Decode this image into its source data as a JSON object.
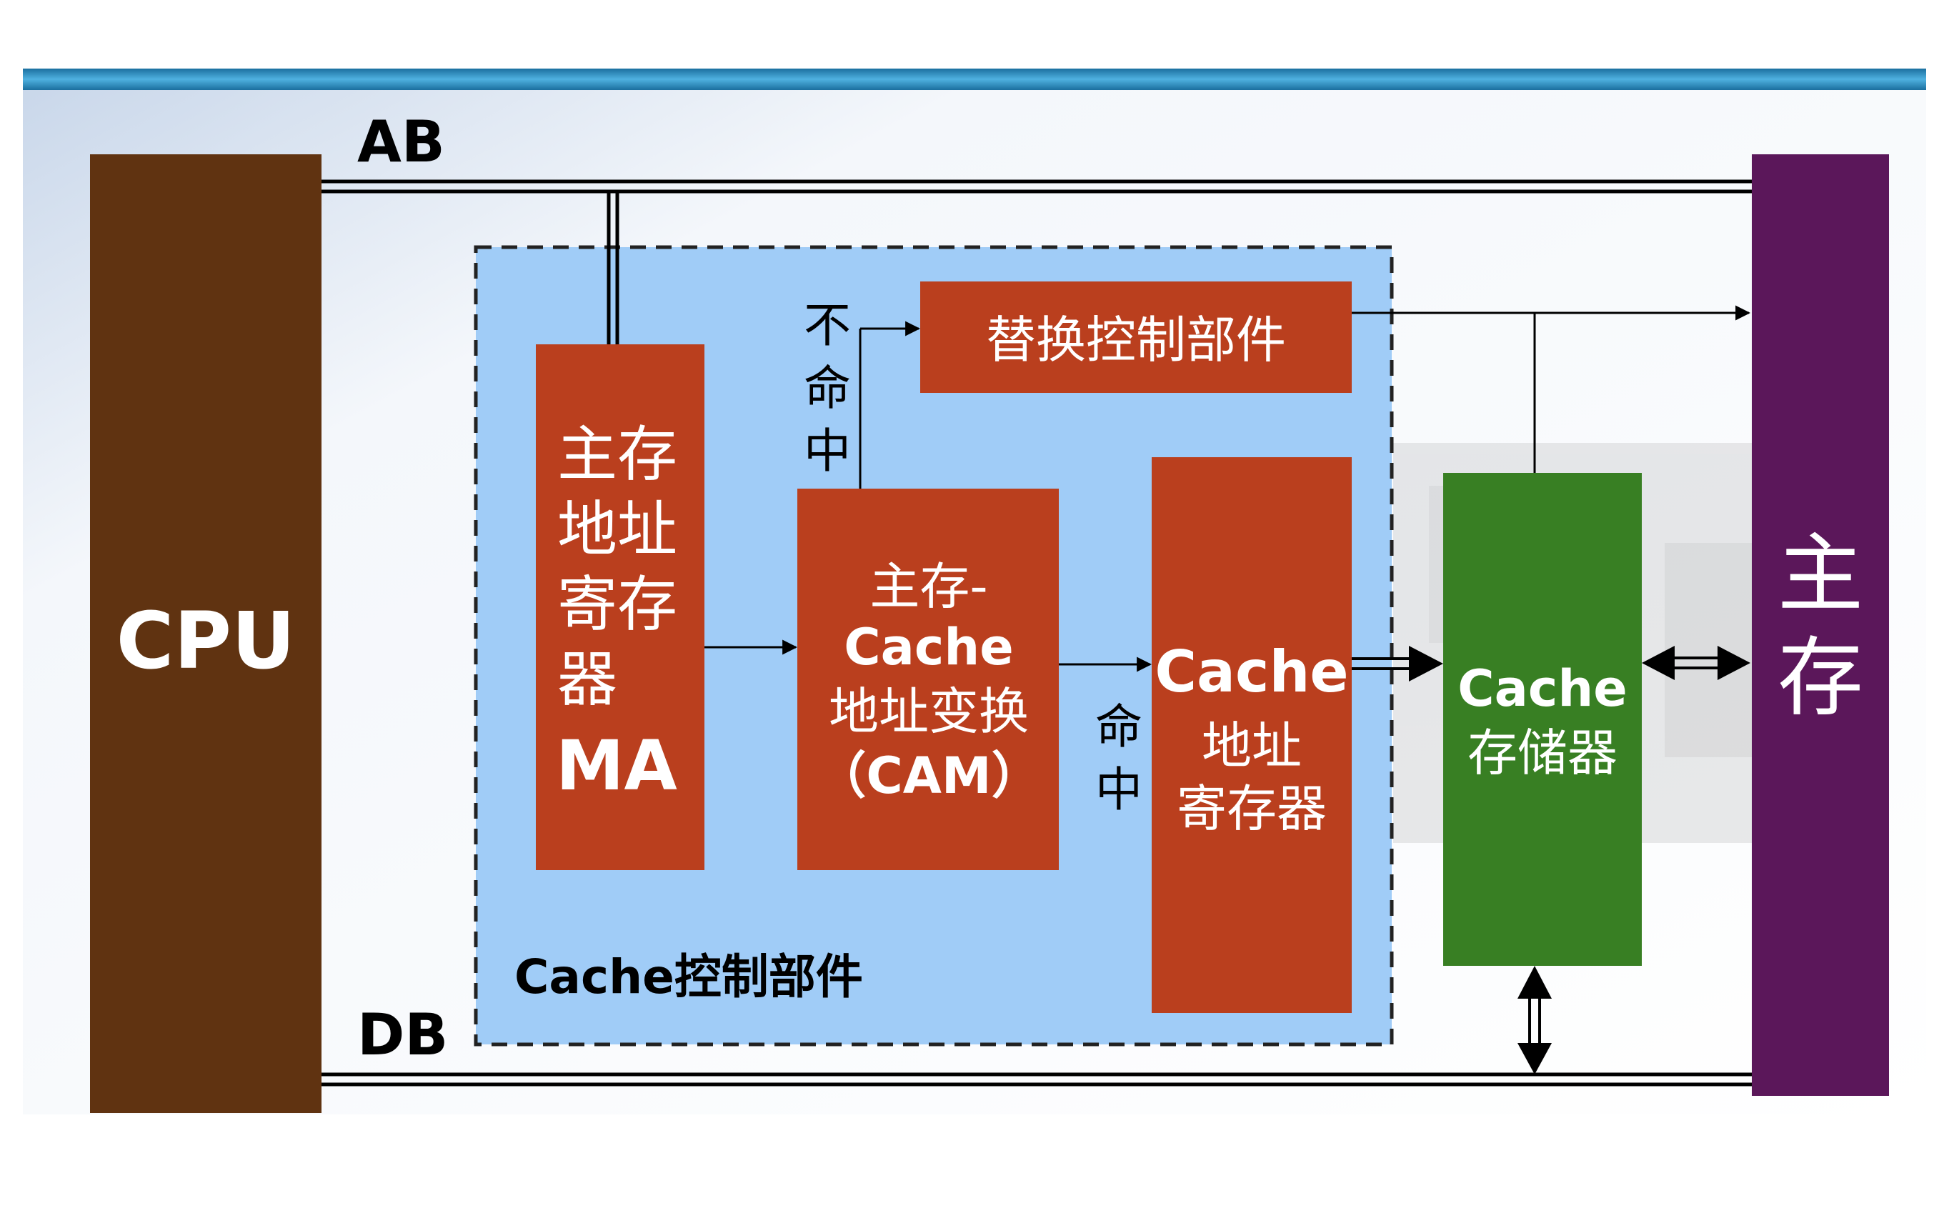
{
  "colors": {
    "top_bar": "#2E97C9",
    "cpu_box": "#603311",
    "main_memory_box": "#5B175A",
    "control_region": "#A0CCF7",
    "red_block": "#BA3F1E",
    "cache_memory_box": "#387F23",
    "text_light": "#FFFFFF",
    "text_dark": "#000000"
  },
  "bus": {
    "address_bus_label": "AB",
    "data_bus_label": "DB"
  },
  "cpu": {
    "label": "CPU"
  },
  "main_memory": {
    "line1": "主",
    "line2": "存"
  },
  "control_unit": {
    "caption": "Cache控制部件"
  },
  "ma_register": {
    "line1": "主存",
    "line2": "地址",
    "line3": "寄存",
    "line4": "器",
    "line5": "MA"
  },
  "cam": {
    "line1": "主存-",
    "line2": "Cache",
    "line3": "地址变换",
    "line4": "（CAM）"
  },
  "replace_unit": {
    "label": "替换控制部件"
  },
  "cache_addr_register": {
    "line1": "Cache",
    "line2": "地址",
    "line3": "寄存器"
  },
  "cache_memory": {
    "line1": "Cache",
    "line2": "存储器"
  },
  "signals": {
    "miss_chars": [
      "不",
      "命",
      "中"
    ],
    "hit_chars": [
      "命",
      "中"
    ]
  }
}
